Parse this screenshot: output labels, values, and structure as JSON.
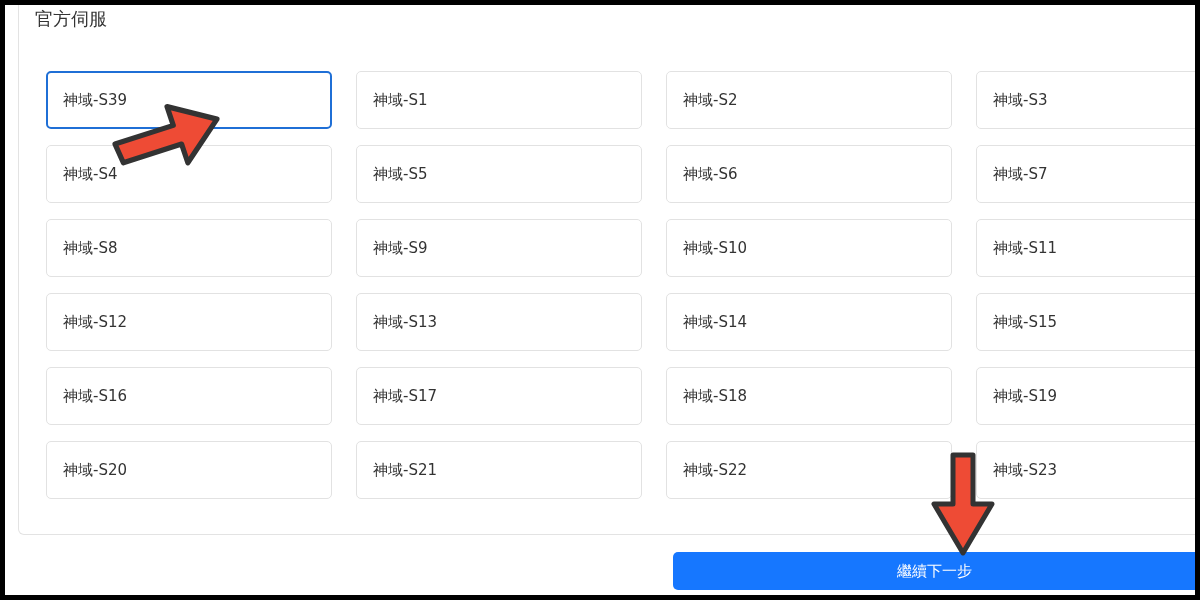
{
  "section": {
    "title": "官方伺服"
  },
  "servers": [
    {
      "label": "神域-S39",
      "selected": true
    },
    {
      "label": "神域-S1",
      "selected": false
    },
    {
      "label": "神域-S2",
      "selected": false
    },
    {
      "label": "神域-S3",
      "selected": false
    },
    {
      "label": "神域-S4",
      "selected": false
    },
    {
      "label": "神域-S5",
      "selected": false
    },
    {
      "label": "神域-S6",
      "selected": false
    },
    {
      "label": "神域-S7",
      "selected": false
    },
    {
      "label": "神域-S8",
      "selected": false
    },
    {
      "label": "神域-S9",
      "selected": false
    },
    {
      "label": "神域-S10",
      "selected": false
    },
    {
      "label": "神域-S11",
      "selected": false
    },
    {
      "label": "神域-S12",
      "selected": false
    },
    {
      "label": "神域-S13",
      "selected": false
    },
    {
      "label": "神域-S14",
      "selected": false
    },
    {
      "label": "神域-S15",
      "selected": false
    },
    {
      "label": "神域-S16",
      "selected": false
    },
    {
      "label": "神域-S17",
      "selected": false
    },
    {
      "label": "神域-S18",
      "selected": false
    },
    {
      "label": "神域-S19",
      "selected": false
    },
    {
      "label": "神域-S20",
      "selected": false
    },
    {
      "label": "神域-S21",
      "selected": false
    },
    {
      "label": "神域-S22",
      "selected": false
    },
    {
      "label": "神域-S23",
      "selected": false
    }
  ],
  "next_button": {
    "label": "繼續下一步"
  }
}
